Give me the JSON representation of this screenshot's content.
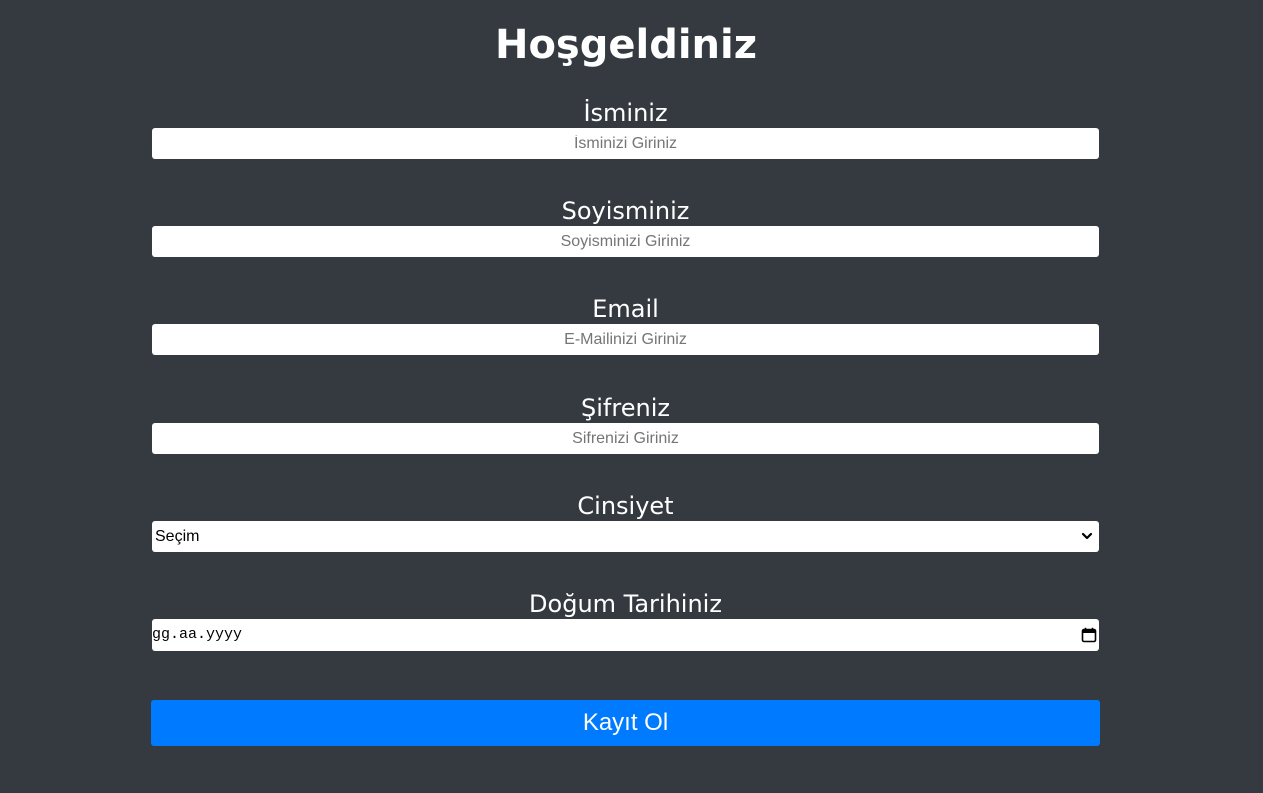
{
  "page": {
    "title": "Hoşgeldiniz"
  },
  "form": {
    "first_name": {
      "label": "İsminiz",
      "placeholder": "İsminizi Giriniz",
      "value": ""
    },
    "last_name": {
      "label": "Soyisminiz",
      "placeholder": "Soyisminizi Giriniz",
      "value": ""
    },
    "email": {
      "label": "Email",
      "placeholder": "E-Mailinizi Giriniz",
      "value": ""
    },
    "password": {
      "label": "Şifreniz",
      "placeholder": "Sifrenizi Giriniz",
      "value": ""
    },
    "gender": {
      "label": "Cinsiyet",
      "selected": "Seçim"
    },
    "birth_date": {
      "label": "Doğum Tarihiniz",
      "placeholder": "gg.aa.yyyy"
    },
    "submit_label": "Kayıt Ol"
  },
  "icons": {
    "select": "chevron-down-icon",
    "date": "calendar-icon"
  },
  "colors": {
    "background": "#343a40",
    "primary": "#007bff",
    "text": "#ffffff"
  }
}
